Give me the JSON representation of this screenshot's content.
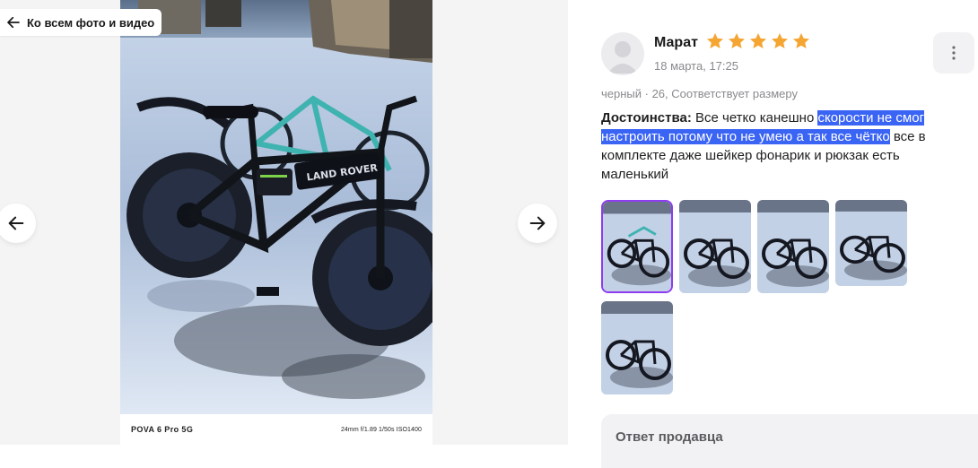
{
  "back_link": {
    "label": "Ко всем фото и видео",
    "icon": "arrow-left-icon"
  },
  "photo": {
    "phone_model": "POVA 6 Pro 5G",
    "exif": "24mm f/1.89 1/50s ISO1400",
    "bike_brand_text": "LAND ROVER"
  },
  "nav": {
    "prev_icon": "arrow-left-icon",
    "next_icon": "arrow-right-icon"
  },
  "review": {
    "author": "Марат",
    "rating": 5,
    "rating_max": 5,
    "star_color": "#f5a532",
    "date": "18 марта, 17:25",
    "meta": "черный · 26, Соответствует размеру",
    "advantages_title": "Достоинства:",
    "text_before": " Все четко канешно ",
    "text_highlighted": "скорости не смог настроить потому что не умею а так все чётко",
    "text_after": " все в комплекте даже шейкер фонарик и рюкзак есть маленький",
    "highlight_color": "#3a64f4",
    "thumbnails_count": 5,
    "selected_thumbnail_index": 0,
    "selected_border_color": "#8e3cf0"
  },
  "seller": {
    "label": "Ответ продавца"
  }
}
